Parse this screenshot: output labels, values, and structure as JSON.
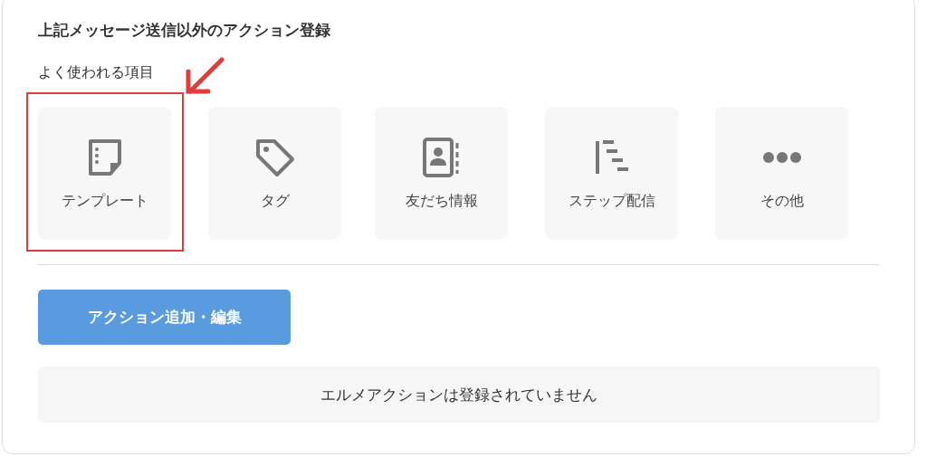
{
  "panel": {
    "title": "上記メッセージ送信以外のアクション登録",
    "subtitle": "よく使われる項目",
    "items": [
      {
        "label": "テンプレート",
        "kind": "note",
        "highlighted": true
      },
      {
        "label": "タグ",
        "kind": "tag",
        "highlighted": false
      },
      {
        "label": "友だち情報",
        "kind": "contact",
        "highlighted": false
      },
      {
        "label": "ステップ配信",
        "kind": "steps",
        "highlighted": false
      },
      {
        "label": "その他",
        "kind": "more",
        "highlighted": false
      }
    ],
    "button": "アクション追加・編集",
    "empty_message": "エルメアクションは登録されていません"
  }
}
